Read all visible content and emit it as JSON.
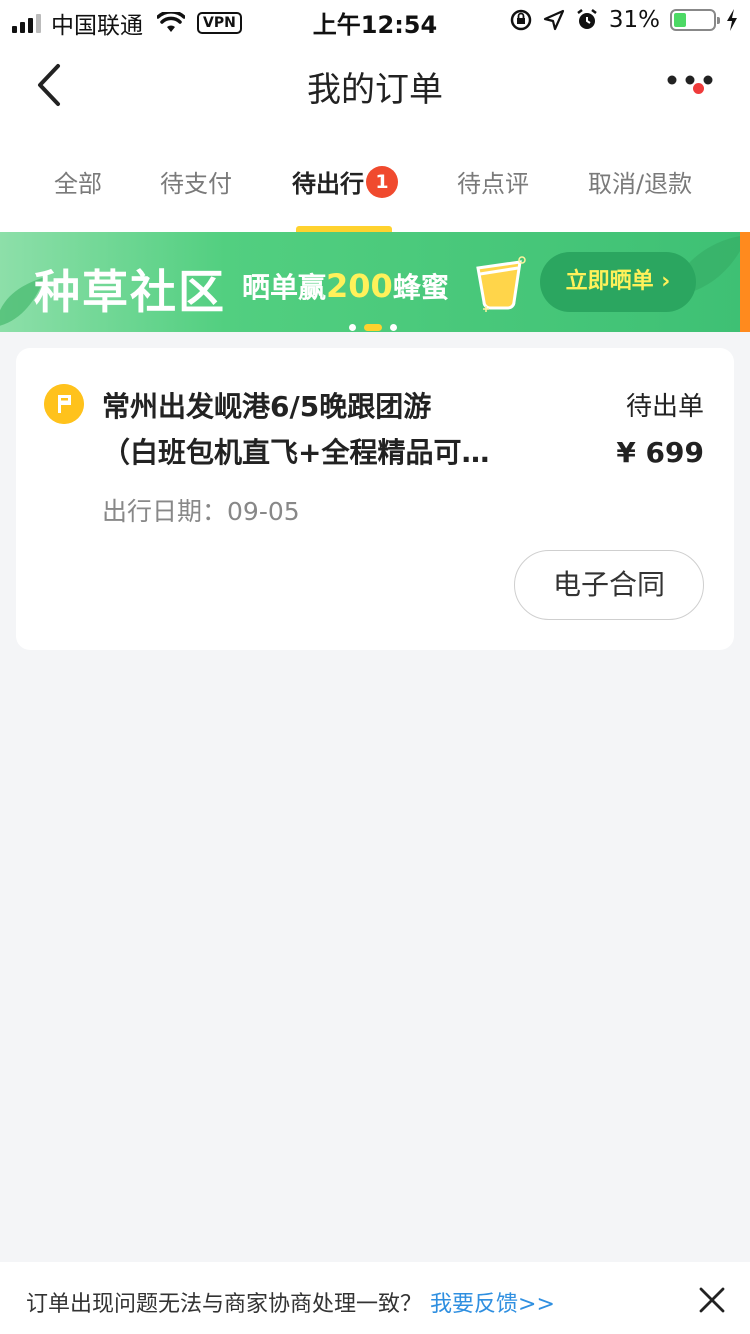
{
  "status_bar": {
    "carrier": "中国联通",
    "vpn": "VPN",
    "time": "上午12:54",
    "battery_percent": "31%",
    "battery_level": 0.31
  },
  "nav": {
    "title": "我的订单"
  },
  "tabs": [
    {
      "label": "全部"
    },
    {
      "label": "待支付"
    },
    {
      "label": "待出行",
      "active": true,
      "badge": "1"
    },
    {
      "label": "待点评"
    },
    {
      "label": "取消/退款"
    }
  ],
  "banner": {
    "title": "种草社区",
    "sub_prefix": "晒单赢",
    "sub_number": "200",
    "sub_suffix": "蜂蜜",
    "button": "立即晒单 ›"
  },
  "order": {
    "title_line1": "常州出发岘港6/5晚跟团游",
    "title_line2": "（白班包机直飞+全程精品可…",
    "status": "待出单",
    "price": "¥ 699",
    "date_label": "出行日期：",
    "date_value": "09-05",
    "contract_button": "电子合同"
  },
  "footer": {
    "text": "订单出现问题无法与商家协商处理一致？",
    "link": "我要反馈>>"
  },
  "colors": {
    "accent_yellow": "#ffd22e",
    "badge_red": "#f04a2e",
    "banner_green": "#3ec074",
    "link_blue": "#2f8fe0"
  }
}
